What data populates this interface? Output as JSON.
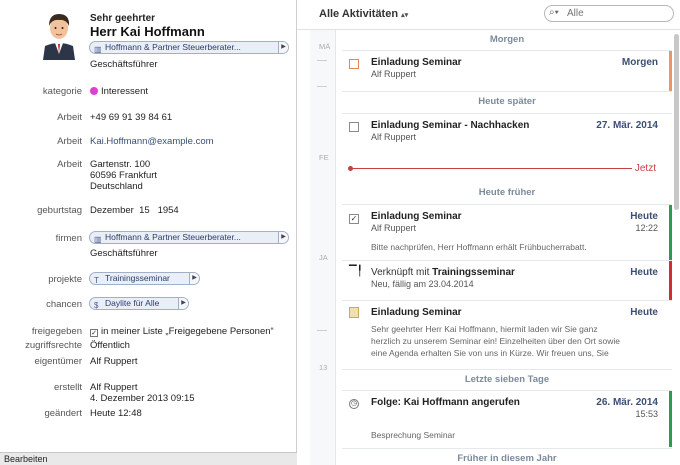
{
  "contact": {
    "greeting": "Sehr geehrter",
    "name": "Herr Kai Hoffmann",
    "company": "Hoffmann & Partner Steuerberater...",
    "position": "Geschäftsführer"
  },
  "fields": {
    "kategorie_label": "kategorie",
    "kategorie_value": "Interessent",
    "phone_label": "Arbeit",
    "phone_value": "+49 69 91 39 84 61",
    "email_label": "Arbeit",
    "email_value": "Kai.Hoffmann@example.com",
    "address_label": "Arbeit",
    "address_value": "Gartenstr. 100\n60596 Frankfurt\nDeutschland",
    "birthday_label": "geburtstag",
    "birthday_value": "Dezember  15   1954",
    "firmen_label": "firmen",
    "firmen_value": "Hoffmann & Partner Steuerberater...",
    "firmen_position": "Geschäftsführer",
    "projekte_label": "projekte",
    "projekte_value": "Trainingsseminar",
    "chancen_label": "chancen",
    "chancen_value": "Daylite für Alle",
    "freigegeben_label": "freigegeben",
    "freigegeben_value": "in meiner Liste „Freigegebene Personen“",
    "zugriff_label": "zugriffsrechte",
    "zugriff_value": "Öffentlich",
    "owner_label": "eigentümer",
    "owner_value": "Alf Ruppert",
    "created_label": "erstellt",
    "created_value": "Alf Ruppert\n4. Dezember 2013 09:15",
    "changed_label": "geändert",
    "changed_value": "Heute 12:48"
  },
  "bottombar": {
    "label": "Bearbeiten"
  },
  "toolbar": {
    "filter_label": "Alle Aktivitäten",
    "search_placeholder": "Alle"
  },
  "timeline": {
    "months": [
      "MÄ",
      "FE",
      "JA",
      "13"
    ]
  },
  "sections": {
    "morgen": "Morgen",
    "heute_spaeter": "Heute später",
    "heute_frueher": "Heute früher",
    "letzte_tage": "Letzte sieben Tage",
    "frueher_jahr": "Früher in diesem Jahr"
  },
  "now_label": "Jetzt",
  "activities": [
    {
      "title": "Einladung Seminar",
      "sub": "Alf Ruppert",
      "date": "Morgen"
    },
    {
      "title": "Einladung Seminar - Nachhacken",
      "sub": "Alf Ruppert",
      "date": "27. Mär. 2014"
    },
    {
      "title": "Einladung Seminar",
      "sub": "Alf Ruppert",
      "date": "Heute",
      "time": "12:22",
      "body": "Bitte nachprüfen, Herr Hoffmann erhält Frühbucherrabatt."
    },
    {
      "title_prefix": "Verknüpft mit",
      "title": "Trainingsseminar",
      "sub": "Neu, fällig am 23.04.2014",
      "date": "Heute"
    },
    {
      "title": "Einladung Seminar",
      "date": "Heute",
      "body1": "Sehr geehrter Herr Kai Hoffmann, hiermit laden wir Sie ganz",
      "body2": "herzlich zu unserem Seminar ein! Einzelheiten über den Ort sowie",
      "body3": "eine Agenda erhalten Sie von uns in Kürze. Wir freuen uns, Sie"
    },
    {
      "title": "Folge: Kai Hoffmann angerufen",
      "date": "26. Mär. 2014",
      "time": "15:53",
      "body": "Besprechung Seminar"
    }
  ],
  "colors": {
    "orange": "#e8956a",
    "green": "#2e9a4a",
    "red": "#cf2f2f",
    "accent_blue": "#3b4f75"
  }
}
